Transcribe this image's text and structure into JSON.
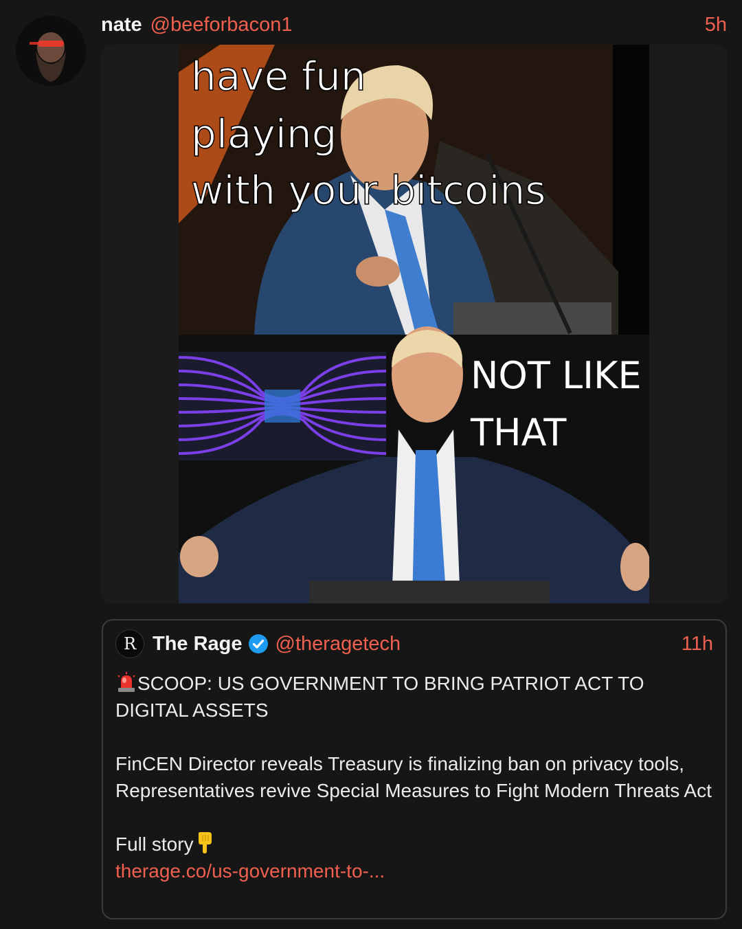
{
  "post": {
    "author_name": "nate",
    "author_handle": "@beeforbacon1",
    "time": "5h",
    "meme_text": {
      "top_line1": "have fun",
      "top_line2": "playing",
      "top_line3": "with your bitcoins",
      "bottom_line1": "NOT LIKE",
      "bottom_line2": "THAT"
    }
  },
  "quoted": {
    "logo_letter": "R",
    "author_name": "The Rage",
    "author_handle": "@theragetech",
    "time": "11h",
    "headline": "SCOOP: US GOVERNMENT TO BRING PATRIOT ACT TO DIGITAL ASSETS",
    "body": "FinCEN Director reveals Treasury is finalizing ban on privacy tools, Representatives revive Special Measures to Fight Modern Threats Act",
    "full_story_label": "Full story",
    "link_text": "therage.co/us-government-to-..."
  },
  "colors": {
    "background": "#161616",
    "accent": "#f0604f",
    "verified_badge": "#1d9bf0",
    "quote_border": "#3c3c3c"
  },
  "icons": {
    "siren": "police-light-emoji",
    "pointing_down": "backhand-index-pointing-down-emoji",
    "verified": "verified-badge-icon"
  }
}
